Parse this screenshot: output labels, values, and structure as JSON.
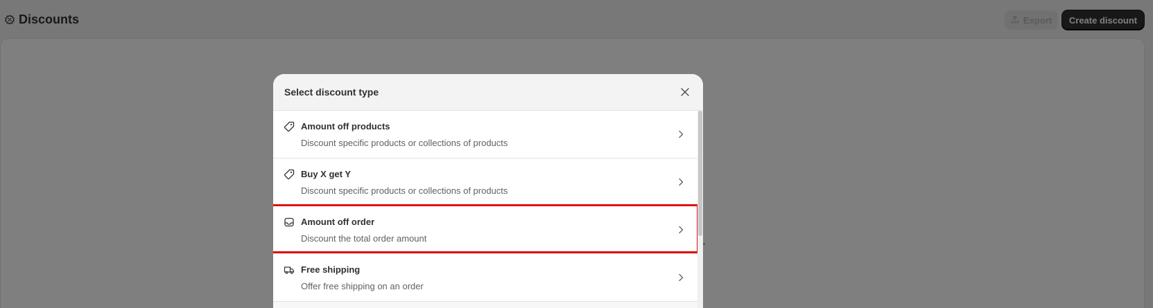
{
  "page": {
    "title": "Discounts",
    "export_label": "Export",
    "create_label": "Create discount"
  },
  "modal": {
    "title": "Select discount type",
    "options": [
      {
        "title": "Amount off products",
        "description": "Discount specific products or collections of products",
        "icon": "tag-icon"
      },
      {
        "title": "Buy X get Y",
        "description": "Discount specific products or collections of products",
        "icon": "tag-icon"
      },
      {
        "title": "Amount off order",
        "description": "Discount the total order amount",
        "icon": "cart-icon",
        "highlighted": true
      },
      {
        "title": "Free shipping",
        "description": "Offer free shipping on an order",
        "icon": "truck-icon"
      }
    ]
  },
  "colors": {
    "overlay": "rgba(0,0,0,0.5)",
    "highlight": "#e01010",
    "primary_button": "#303030"
  }
}
